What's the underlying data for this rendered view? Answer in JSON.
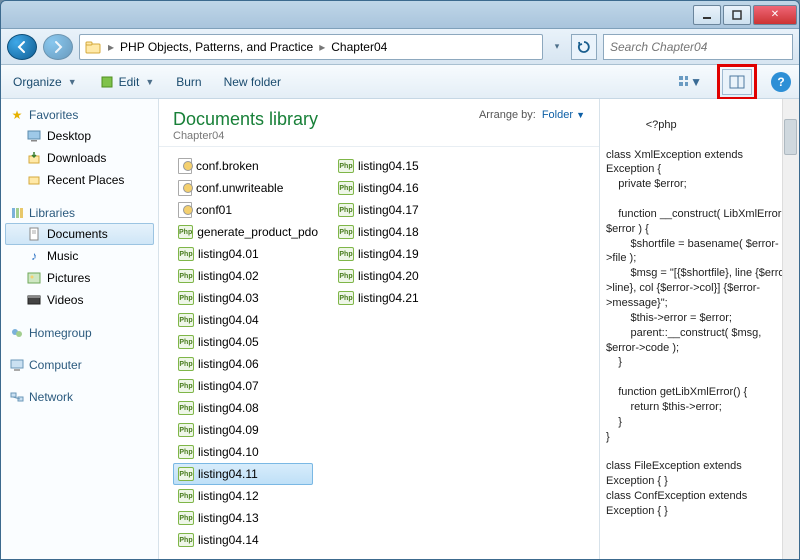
{
  "breadcrumb": {
    "part1": "PHP Objects, Patterns, and Practice",
    "part2": "Chapter04"
  },
  "search": {
    "placeholder": "Search Chapter04"
  },
  "toolbar": {
    "organize": "Organize",
    "edit": "Edit",
    "burn": "Burn",
    "newfolder": "New folder"
  },
  "nav": {
    "favorites": "Favorites",
    "desktop": "Desktop",
    "downloads": "Downloads",
    "recent": "Recent Places",
    "libraries": "Libraries",
    "documents": "Documents",
    "music": "Music",
    "pictures": "Pictures",
    "videos": "Videos",
    "homegroup": "Homegroup",
    "computer": "Computer",
    "network": "Network"
  },
  "lib": {
    "title": "Documents library",
    "subtitle": "Chapter04",
    "arrange_label": "Arrange by:",
    "arrange_value": "Folder"
  },
  "files_col1": [
    {
      "name": "conf.broken",
      "type": "ini"
    },
    {
      "name": "conf.unwriteable",
      "type": "ini"
    },
    {
      "name": "conf01",
      "type": "ini"
    },
    {
      "name": "generate_product_pdo",
      "type": "php"
    },
    {
      "name": "listing04.01",
      "type": "php"
    },
    {
      "name": "listing04.02",
      "type": "php"
    },
    {
      "name": "listing04.03",
      "type": "php"
    },
    {
      "name": "listing04.04",
      "type": "php"
    },
    {
      "name": "listing04.05",
      "type": "php"
    },
    {
      "name": "listing04.06",
      "type": "php"
    },
    {
      "name": "listing04.07",
      "type": "php"
    },
    {
      "name": "listing04.08",
      "type": "php"
    },
    {
      "name": "listing04.09",
      "type": "php"
    },
    {
      "name": "listing04.10",
      "type": "php"
    },
    {
      "name": "listing04.11",
      "type": "php",
      "selected": true
    },
    {
      "name": "listing04.12",
      "type": "php"
    },
    {
      "name": "listing04.13",
      "type": "php"
    },
    {
      "name": "listing04.14",
      "type": "php"
    }
  ],
  "files_col2": [
    {
      "name": "listing04.15",
      "type": "php"
    },
    {
      "name": "listing04.16",
      "type": "php"
    },
    {
      "name": "listing04.17",
      "type": "php"
    },
    {
      "name": "listing04.18",
      "type": "php"
    },
    {
      "name": "listing04.19",
      "type": "php"
    },
    {
      "name": "listing04.20",
      "type": "php"
    },
    {
      "name": "listing04.21",
      "type": "php"
    }
  ],
  "preview_text": "<?php\n\nclass XmlException extends Exception {\n    private $error;\n\n    function __construct( LibXmlError $error ) {\n        $shortfile = basename( $error->file );\n        $msg = \"[{$shortfile}, line {$error->line}, col {$error->col}] {$error->message}\";\n        $this->error = $error;\n        parent::__construct( $msg, $error->code );\n    }\n\n    function getLibXmlError() {\n        return $this->error;\n    }\n}\n\nclass FileException extends Exception { }\nclass ConfException extends Exception { }"
}
